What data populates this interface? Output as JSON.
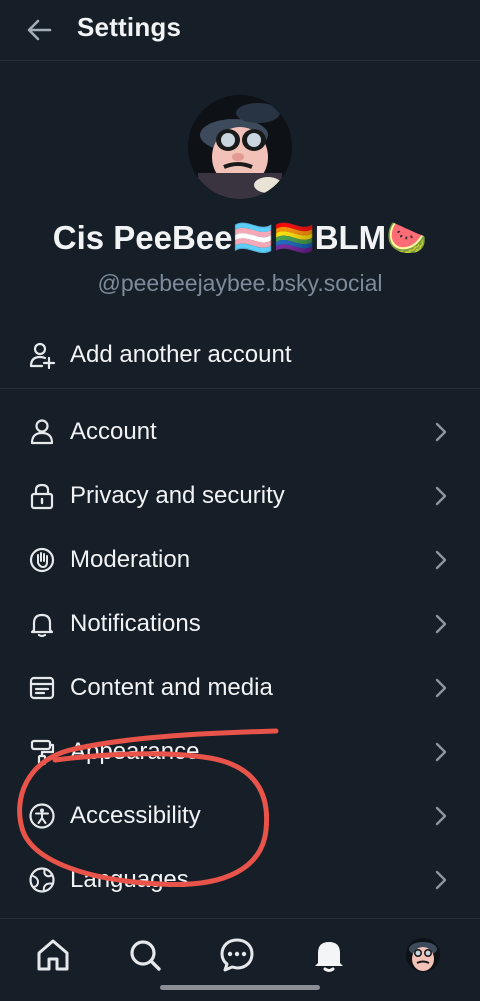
{
  "header": {
    "title": "Settings"
  },
  "profile": {
    "display_name": "Cis PeeBee🏳️‍⚧️🏳️‍🌈BLM🍉",
    "handle": "@peebeejaybee.bsky.social"
  },
  "add_account": {
    "label": "Add another account",
    "icon": "add-person-icon"
  },
  "menu": [
    {
      "label": "Account",
      "icon": "person-icon"
    },
    {
      "label": "Privacy and security",
      "icon": "lock-icon"
    },
    {
      "label": "Moderation",
      "icon": "raised-hand-icon"
    },
    {
      "label": "Notifications",
      "icon": "bell-icon"
    },
    {
      "label": "Content and media",
      "icon": "browser-window-icon"
    },
    {
      "label": "Appearance",
      "icon": "paint-roller-icon"
    },
    {
      "label": "Accessibility",
      "icon": "accessibility-icon"
    },
    {
      "label": "Languages",
      "icon": "globe-icon"
    }
  ],
  "tabs": [
    "home-icon",
    "search-icon",
    "chat-icon",
    "bell-icon",
    "avatar"
  ],
  "colors": {
    "background": "#161e27",
    "annotation": "#e8534a",
    "muted_text": "#7c8a99"
  }
}
